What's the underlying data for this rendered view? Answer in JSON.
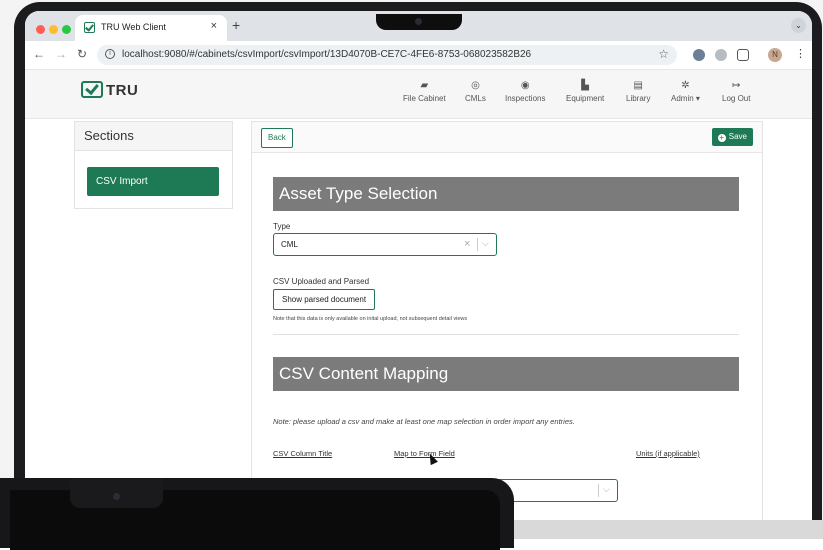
{
  "browser": {
    "tab_title": "TRU Web Client",
    "tab_close": "×",
    "new_tab": "+",
    "tab_menu": "⌄",
    "url": "localhost:9080/#/cabinets/csvImport/csvImport/13D4070B-CE7C-4FE6-8753-068023582B26",
    "profile_initial": "N"
  },
  "app": {
    "logo_text": "TRU",
    "nav": [
      {
        "label": "File Cabinet",
        "icon": "folder-icon"
      },
      {
        "label": "CMLs",
        "icon": "target-icon"
      },
      {
        "label": "Inspections",
        "icon": "eye-icon"
      },
      {
        "label": "Equipment",
        "icon": "factory-icon"
      },
      {
        "label": "Library",
        "icon": "book-icon"
      },
      {
        "label": "Admin ▾",
        "icon": "gear-icon"
      },
      {
        "label": "Log Out",
        "icon": "logout-icon"
      }
    ]
  },
  "sidebar": {
    "title": "Sections",
    "items": [
      {
        "label": "CSV Import"
      }
    ]
  },
  "toolbar": {
    "back_label": "Back",
    "save_label": "Save"
  },
  "asset_section": {
    "title": "Asset Type Selection",
    "type_label": "Type",
    "type_value": "CML",
    "csv_label": "CSV Uploaded and Parsed",
    "show_button": "Show parsed document",
    "note": "Note that this data is only available on inital upload, not subsequent detail views"
  },
  "mapping_section": {
    "title": "CSV Content Mapping",
    "note": "Note: please upload a csv and make at least one map selection in order import any entries.",
    "columns": [
      "CSV Column Title",
      "Map to Form Field",
      "Units (if applicable)"
    ]
  },
  "colors": {
    "accent": "#1e7a55",
    "banner": "#7b7b7b"
  }
}
